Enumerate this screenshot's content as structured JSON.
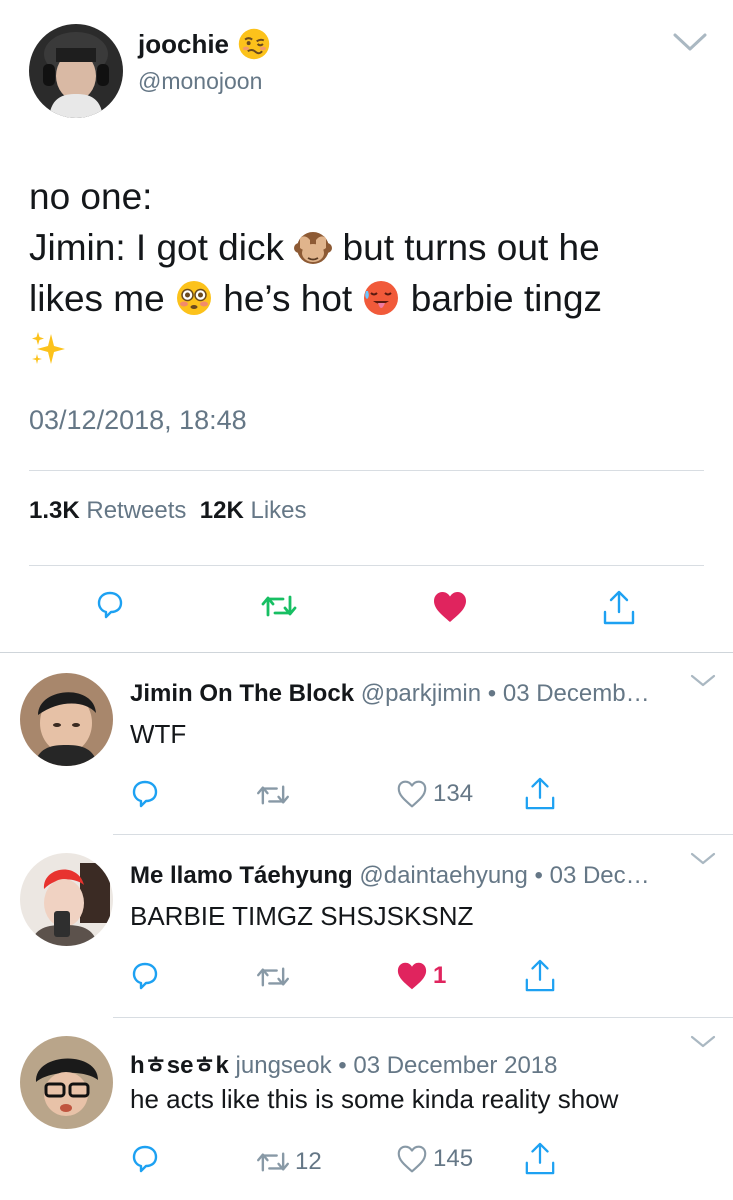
{
  "main_tweet": {
    "display_name": "joochie",
    "name_emoji": "woozy-face",
    "handle": "@monojoon",
    "text_line1": "no one:",
    "text_line2_a": "Jimin: I got dick",
    "text_line2_emoji": "see-no-evil-monkey",
    "text_line2_b": "but turns out he",
    "text_line3_a": "likes me",
    "text_line3_emoji1": "flushed-face",
    "text_line3_b": "he’s hot",
    "text_line3_emoji2": "hot-face",
    "text_line3_c": "barbie tingz",
    "text_line4_emoji": "sparkles",
    "timestamp": "03/12/2018, 18:48",
    "retweets_count": "1.3K",
    "retweets_label": "Retweets",
    "likes_count": "12K",
    "likes_label": "Likes",
    "liked": true,
    "colors": {
      "retweet_green": "#17bf63",
      "like_red": "#e0245e",
      "icon_blue": "#1da1f2",
      "muted": "#657786"
    }
  },
  "replies": [
    {
      "display_name": "Jimin On The Block",
      "meta": "@parkjimin • 03 Decemb…",
      "text": "WTF",
      "reply_count": "",
      "retweet_count": "",
      "like_count": "134",
      "liked": false
    },
    {
      "display_name": "Me llamo Táehyung",
      "meta": "@daintaehyung • 03 Dec…",
      "text": "BARBIE TIMGZ SHSJSKSNZ",
      "reply_count": "",
      "retweet_count": "",
      "like_count": "1",
      "liked": true
    },
    {
      "display_name": "hㅎseㅎk",
      "meta": "jungseok • 03 December 2018",
      "text": "he acts like this is some kinda reality show",
      "reply_count": "",
      "retweet_count": "12",
      "like_count": "145",
      "liked": false
    }
  ]
}
